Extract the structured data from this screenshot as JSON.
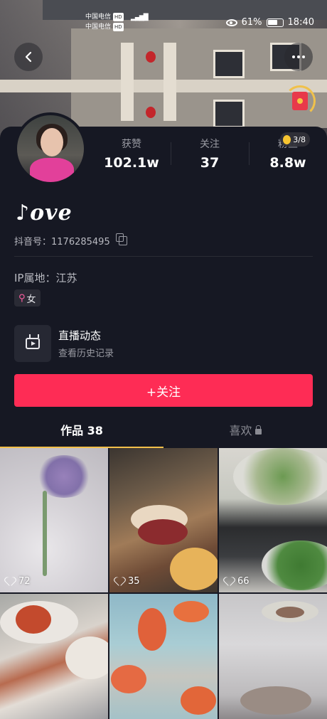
{
  "status_bar": {
    "carrier_1": "中国电信",
    "carrier_2": "中国电信",
    "hd_badge": "HD",
    "battery_percent": "61%",
    "time": "18:40",
    "icons": [
      "eye-icon",
      "battery-icon",
      "signal-icon"
    ]
  },
  "header": {
    "back_icon": "back-arrow-icon",
    "more_icon": "more-dots-icon",
    "redpacket_icon": "red-packet-icon"
  },
  "profile": {
    "nickname": "♪ove",
    "douyin_id": "抖音号：1176285495",
    "ip_location": "IP属地：江苏",
    "gender": "女",
    "gender_icon": "female-icon",
    "stats": [
      {
        "label": "获赞",
        "value": "102.1w"
      },
      {
        "label": "关注",
        "value": "37"
      },
      {
        "label": "粉丝",
        "value": "8.8w"
      }
    ],
    "fans_badge": "3/8"
  },
  "live": {
    "title": "直播动态",
    "subtitle": "查看历史记录",
    "icon": "tv-icon"
  },
  "follow_button": "+关注",
  "tabs": [
    {
      "label": "作品 38",
      "active": true
    },
    {
      "label": "喜欢",
      "active": false,
      "locked": true
    }
  ],
  "videos": [
    {
      "likes": "72"
    },
    {
      "likes": "35"
    },
    {
      "likes": "66"
    },
    {
      "likes": ""
    },
    {
      "likes": ""
    },
    {
      "likes": ""
    }
  ],
  "colors": {
    "background": "#161823",
    "accent": "#fe2c55",
    "tab_underline": "#f3c04a",
    "secondary_text": "#9a9ba3"
  }
}
